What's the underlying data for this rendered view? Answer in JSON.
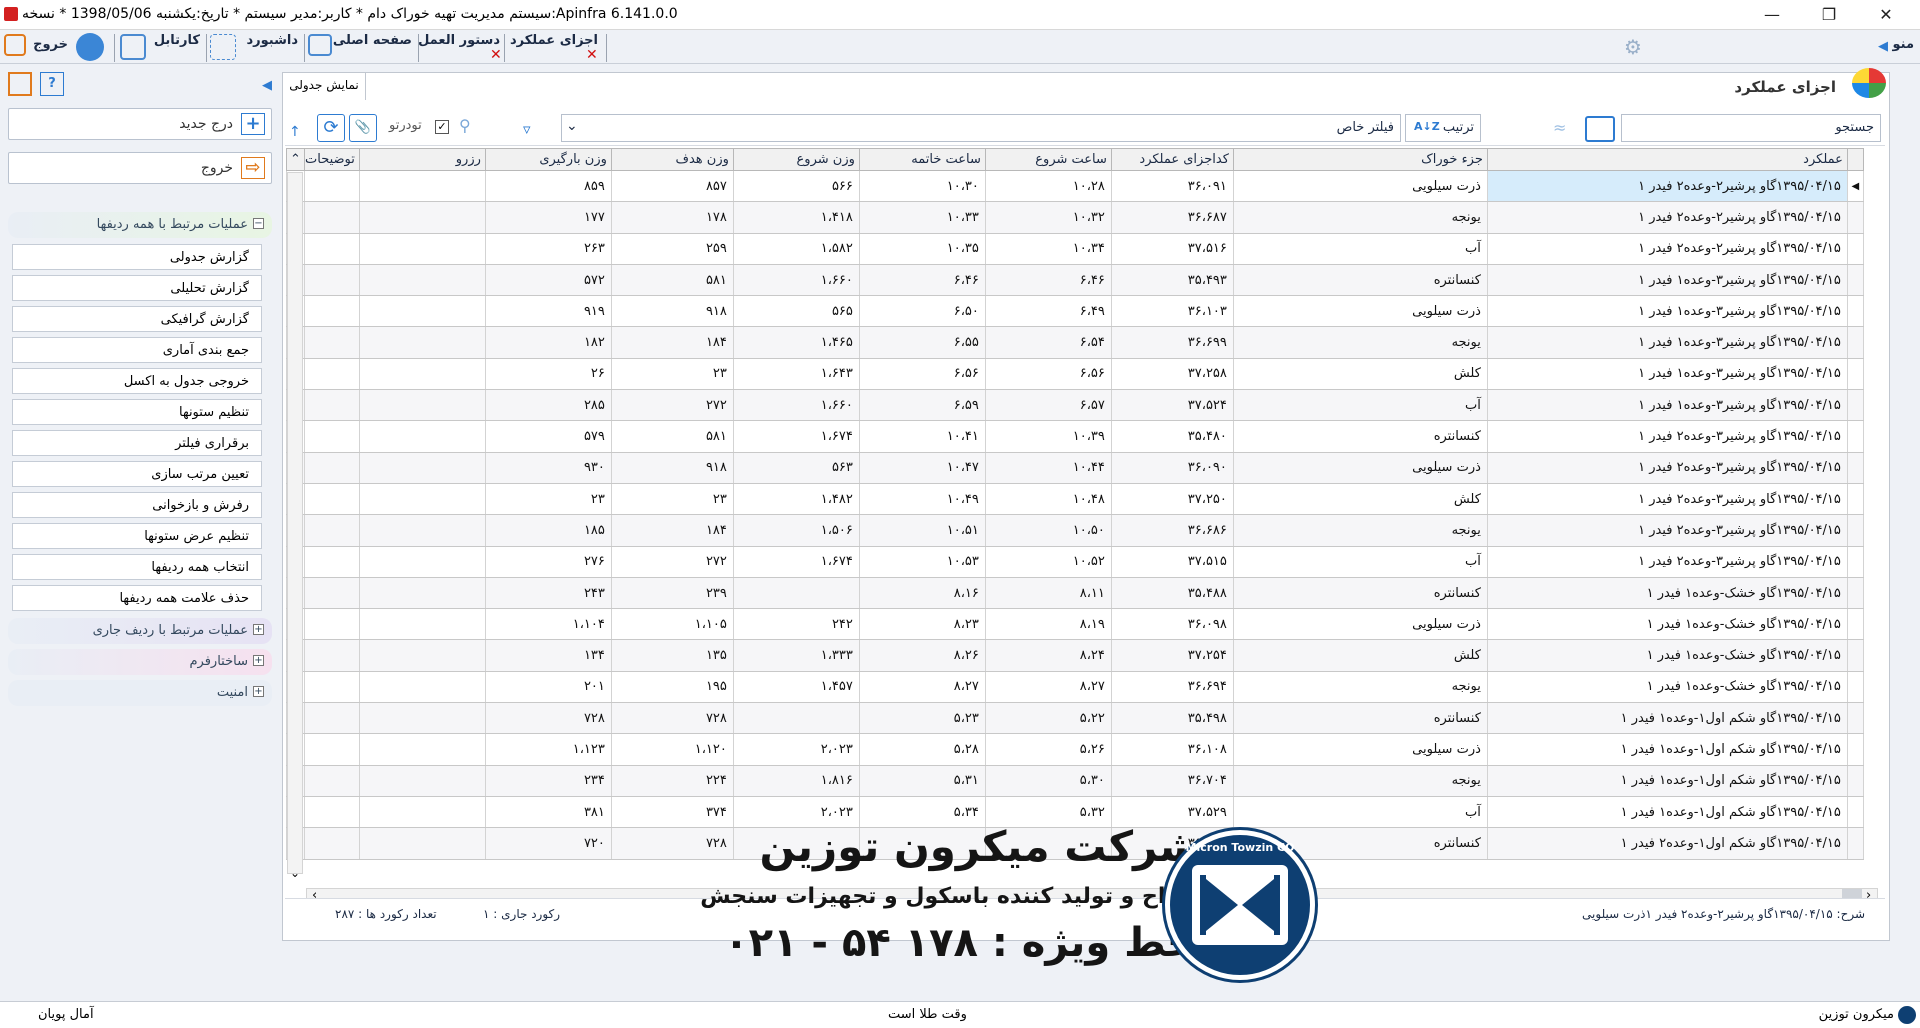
{
  "window": {
    "title": "سیستم مدیریت تهیه خوراک دام * کاربر:مدیر سیستم * تاریخ:یکشنبه 1398/05/06 * نسخه:Apinfra 6.141.0.0"
  },
  "tabs": [
    {
      "label": "منو"
    },
    {
      "label": "اجزای عملکرد"
    },
    {
      "label": "دستور العمل"
    },
    {
      "label": "صفحه اصلی"
    },
    {
      "label": "داشبورد"
    },
    {
      "label": "کارتابل"
    },
    {
      "label": "خروج"
    }
  ],
  "sidebar": {
    "insert_label": "درج جدید",
    "exit_label": "خروج",
    "group_all_rows": "عملیات مرتبط با همه ردیفها",
    "items": [
      {
        "label": "گزارش جدولی"
      },
      {
        "label": "گزارش تحلیلی"
      },
      {
        "label": "گزارش گرافیکی"
      },
      {
        "label": "جمع بندی آماری"
      },
      {
        "label": "خروجی جدول به اکسل"
      },
      {
        "label": "تنظیم ستونها"
      },
      {
        "label": "برقراری فیلتر"
      },
      {
        "label": "تعیین مرتب سازی"
      },
      {
        "label": "رفرش و بازخوانی"
      },
      {
        "label": "تنظیم عرض ستونها"
      },
      {
        "label": "انتخاب همه ردیفها"
      },
      {
        "label": "حذف علامت همه ردیفها"
      }
    ],
    "group_current_row": "عملیات مرتبط با ردیف جاری",
    "group_form": "ساختارفرم",
    "group_security": "امنیت"
  },
  "page": {
    "title": "اجزای عملکرد",
    "view_tab": "نمایش جدولی"
  },
  "toolbar": {
    "search_label": "جستجو",
    "search_value": "",
    "sort_label": "ترتیب",
    "special_filter_label": "فیلتر خاص",
    "nested_label": "تودرتو"
  },
  "columns": [
    "عملکرد",
    "جزء خوراک",
    "کداجزای عملکرد",
    "ساعت شروع",
    "ساعت خاتمه",
    "وزن شروع",
    "وزن هدف",
    "وزن بارگیری",
    "رزرو",
    "توضیحات"
  ],
  "rows": [
    [
      "۱۳۹۵/۰۴/۱۵گاو پرشیر۲-وعده۲   فیدر ۱",
      "ذرت سیلویی",
      "۳۶،۰۹۱",
      "۱۰،۲۸",
      "۱۰،۳۰",
      "۵۶۶",
      "۸۵۷",
      "۸۵۹",
      "",
      ""
    ],
    [
      "۱۳۹۵/۰۴/۱۵گاو پرشیر۲-وعده۲   فیدر ۱",
      "یونجه",
      "۳۶،۶۸۷",
      "۱۰،۳۲",
      "۱۰،۳۳",
      "۱،۴۱۸",
      "۱۷۸",
      "۱۷۷",
      "",
      ""
    ],
    [
      "۱۳۹۵/۰۴/۱۵گاو پرشیر۲-وعده۲   فیدر ۱",
      "آب",
      "۳۷،۵۱۶",
      "۱۰،۳۴",
      "۱۰،۳۵",
      "۱،۵۸۲",
      "۲۵۹",
      "۲۶۳",
      "",
      ""
    ],
    [
      "۱۳۹۵/۰۴/۱۵گاو پرشیر۳-وعده۱   فیدر ۱",
      "کنسانتره",
      "۳۵،۴۹۳",
      "۶،۴۶",
      "۶،۴۶",
      "۱،۶۶۰",
      "۵۸۱",
      "۵۷۲",
      "",
      ""
    ],
    [
      "۱۳۹۵/۰۴/۱۵گاو پرشیر۳-وعده۱   فیدر ۱",
      "ذرت سیلویی",
      "۳۶،۱۰۳",
      "۶،۴۹",
      "۶،۵۰",
      "۵۶۵",
      "۹۱۸",
      "۹۱۹",
      "",
      ""
    ],
    [
      "۱۳۹۵/۰۴/۱۵گاو پرشیر۳-وعده۱   فیدر ۱",
      "یونجه",
      "۳۶،۶۹۹",
      "۶،۵۴",
      "۶،۵۵",
      "۱،۴۶۵",
      "۱۸۴",
      "۱۸۲",
      "",
      ""
    ],
    [
      "۱۳۹۵/۰۴/۱۵گاو پرشیر۳-وعده۱   فیدر ۱",
      "کلش",
      "۳۷،۲۵۸",
      "۶،۵۶",
      "۶،۵۶",
      "۱،۶۴۳",
      "۲۳",
      "۲۶",
      "",
      ""
    ],
    [
      "۱۳۹۵/۰۴/۱۵گاو پرشیر۳-وعده۱   فیدر ۱",
      "آب",
      "۳۷،۵۲۴",
      "۶،۵۷",
      "۶،۵۹",
      "۱،۶۶۰",
      "۲۷۲",
      "۲۸۵",
      "",
      ""
    ],
    [
      "۱۳۹۵/۰۴/۱۵گاو پرشیر۳-وعده۲   فیدر ۱",
      "کنسانتره",
      "۳۵،۴۸۰",
      "۱۰،۳۹",
      "۱۰،۴۱",
      "۱،۶۷۴",
      "۵۸۱",
      "۵۷۹",
      "",
      ""
    ],
    [
      "۱۳۹۵/۰۴/۱۵گاو پرشیر۳-وعده۲   فیدر ۱",
      "ذرت سیلویی",
      "۳۶،۰۹۰",
      "۱۰،۴۴",
      "۱۰،۴۷",
      "۵۶۳",
      "۹۱۸",
      "۹۳۰",
      "",
      ""
    ],
    [
      "۱۳۹۵/۰۴/۱۵گاو پرشیر۳-وعده۲   فیدر ۱",
      "کلش",
      "۳۷،۲۵۰",
      "۱۰،۴۸",
      "۱۰،۴۹",
      "۱،۴۸۲",
      "۲۳",
      "۲۳",
      "",
      ""
    ],
    [
      "۱۳۹۵/۰۴/۱۵گاو پرشیر۳-وعده۲   فیدر ۱",
      "یونجه",
      "۳۶،۶۸۶",
      "۱۰،۵۰",
      "۱۰،۵۱",
      "۱،۵۰۶",
      "۱۸۴",
      "۱۸۵",
      "",
      ""
    ],
    [
      "۱۳۹۵/۰۴/۱۵گاو پرشیر۳-وعده۲   فیدر ۱",
      "آب",
      "۳۷،۵۱۵",
      "۱۰،۵۲",
      "۱۰،۵۳",
      "۱،۶۷۴",
      "۲۷۲",
      "۲۷۶",
      "",
      ""
    ],
    [
      "۱۳۹۵/۰۴/۱۵گاو خشک-وعده۱     فیدر ۱",
      "کنسانتره",
      "۳۵،۴۸۸",
      "۸،۱۱",
      "۸،۱۶",
      "",
      "۲۳۹",
      "۲۴۳",
      "",
      ""
    ],
    [
      "۱۳۹۵/۰۴/۱۵گاو خشک-وعده۱     فیدر ۱",
      "ذرت سیلویی",
      "۳۶،۰۹۸",
      "۸،۱۹",
      "۸،۲۳",
      "۲۴۲",
      "۱،۱۰۵",
      "۱،۱۰۴",
      "",
      ""
    ],
    [
      "۱۳۹۵/۰۴/۱۵گاو خشک-وعده۱     فیدر ۱",
      "کلش",
      "۳۷،۲۵۴",
      "۸،۲۴",
      "۸،۲۶",
      "۱،۳۳۳",
      "۱۳۵",
      "۱۳۴",
      "",
      ""
    ],
    [
      "۱۳۹۵/۰۴/۱۵گاو خشک-وعده۱     فیدر ۱",
      "یونجه",
      "۳۶،۶۹۴",
      "۸،۲۷",
      "۸،۲۷",
      "۱،۴۵۷",
      "۱۹۵",
      "۲۰۱",
      "",
      ""
    ],
    [
      "۱۳۹۵/۰۴/۱۵گاو شکم اول۱-وعده۱  فیدر ۱",
      "کنسانتره",
      "۳۵،۴۹۸",
      "۵،۲۲",
      "۵،۲۳",
      "",
      "۷۲۸",
      "۷۲۸",
      "",
      ""
    ],
    [
      "۱۳۹۵/۰۴/۱۵گاو شکم اول۱-وعده۱  فیدر ۱",
      "ذرت سیلویی",
      "۳۶،۱۰۸",
      "۵،۲۶",
      "۵،۲۸",
      "۲،۰۲۳",
      "۱،۱۲۰",
      "۱،۱۲۳",
      "",
      ""
    ],
    [
      "۱۳۹۵/۰۴/۱۵گاو شکم اول۱-وعده۱  فیدر ۱",
      "یونجه",
      "۳۶،۷۰۴",
      "۵،۳۰",
      "۵،۳۱",
      "۱،۸۱۶",
      "۲۲۴",
      "۲۳۴",
      "",
      ""
    ],
    [
      "۱۳۹۵/۰۴/۱۵گاو شکم اول۱-وعده۱  فیدر ۱",
      "آب",
      "۳۷،۵۲۹",
      "۵،۳۲",
      "۵،۳۴",
      "۲،۰۲۳",
      "۳۷۴",
      "۳۸۱",
      "",
      ""
    ],
    [
      "۱۳۹۵/۰۴/۱۵گاو شکم اول۱-وعده۲  فیدر ۱",
      "کنسانتره",
      "۳۵،۴۸۶",
      "",
      "",
      "",
      "۷۲۸",
      "۷۲۰",
      "",
      ""
    ]
  ],
  "footer": {
    "description": "شرح: ۱۳۹۵/۰۴/۱۵گاو پرشیر۲-وعده۲   فیدر ۱ذرت سیلویی",
    "current_record": "رکورد جاری :  ۱",
    "record_count": "تعداد رکورد ها : ۲۸۷"
  },
  "status": {
    "left": "آمال پویان",
    "center": "وقت طلا است",
    "right": "میکرون توزین"
  },
  "overlay": {
    "company": "شرکت میکرون توزین",
    "subtitle": "طراح و تولید کننده باسکول و تجهیزات سنجش",
    "hotline": "خط ویژه : ۱۷۸ ۵۴ - ۰۲۱",
    "logo_text": "Micron Towzin CO"
  },
  "colors": {
    "accent": "#2d7bd1",
    "danger": "#d21010",
    "selection": "#d6ecfb",
    "logo": "#0e3f72"
  }
}
